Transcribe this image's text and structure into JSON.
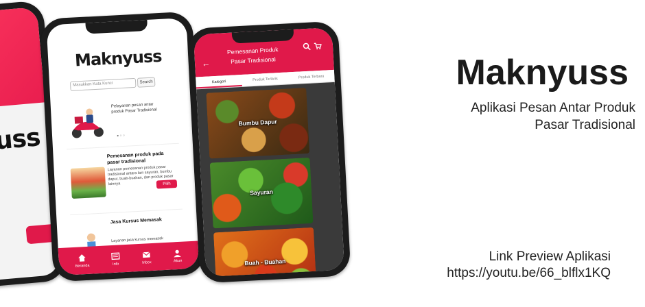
{
  "title": "Maknyuss",
  "subtitle_line1": "Aplikasi Pesan Antar Produk",
  "subtitle_line2": "Pasar Tradisional",
  "link_label": "Link Preview Aplikasi",
  "link_url": "https://youtu.be/66_blflx1KQ",
  "phone1": {
    "logo": "uss"
  },
  "phone2": {
    "logo": "Maknyuss",
    "search_placeholder": "Masukkan Kata Kunci",
    "search_button": "Search",
    "promo_text": "Pelayanan pesan antar produk Pasar Tradisional",
    "card1": {
      "title": "Pemesanan produk pada pasar tradisional",
      "body": "Layanan pemesanan produk pasar tradisional antara lain sayuran, bumbu dapur, buah-buahan, dan produk pasar lainnya",
      "button": "Pilih"
    },
    "card2": {
      "title": "Jasa Kursus Memasak",
      "body": "Layanan jasa kursus memasak"
    },
    "nav": [
      "Beranda",
      "Info",
      "Inbox",
      "Akun"
    ]
  },
  "phone3": {
    "header_title_line1": "Pemesanan Produk",
    "header_title_line2": "Pasar Tradisional",
    "tabs": [
      "Kategori",
      "Produk Terlaris",
      "Produk Terbaru"
    ],
    "categories": [
      "Bumbu Dapur",
      "Sayuran",
      "Buah - Buahan"
    ]
  },
  "colors": {
    "accent": "#e0194a",
    "title": "#1a1a1a"
  }
}
